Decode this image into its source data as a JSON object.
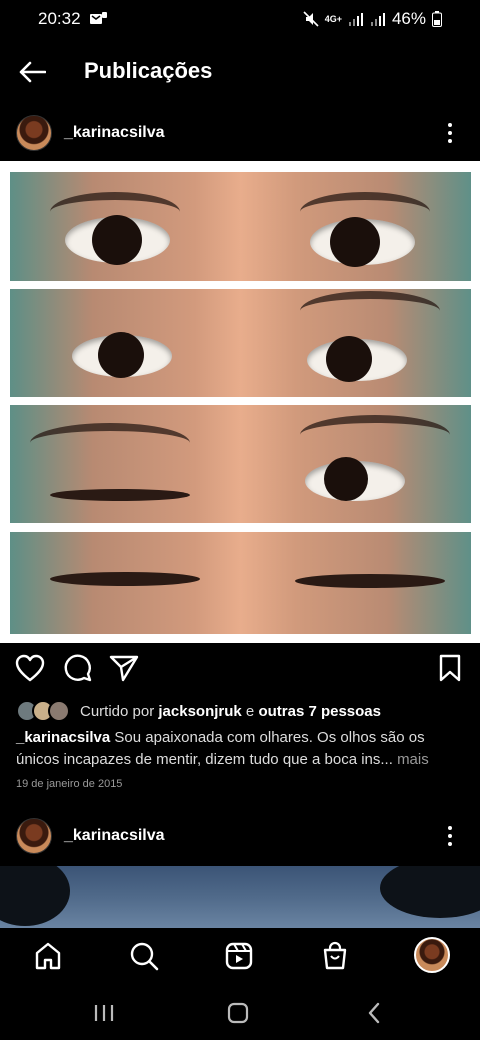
{
  "status_bar": {
    "time": "20:32",
    "battery": "46%",
    "network": "4G+"
  },
  "header": {
    "title": "Publicações",
    "back_icon": "arrow-left-icon"
  },
  "post": {
    "username": "_karinacsilva",
    "liked_by_prefix": "Curtido por",
    "liked_by_user": "jacksonjruk",
    "liked_by_and": "e",
    "liked_by_others": "outras 7 pessoas",
    "caption_user": "_karinacsilva",
    "caption_text": "Sou apaixonada com olhares. Os olhos são os únicos incapazes de mentir, dizem tudo que a boca ins...",
    "caption_more": "mais",
    "date": "19 de janeiro de 2015"
  },
  "post2": {
    "username": "_karinacsilva"
  },
  "colors": {
    "background": "#000000",
    "text": "#ffffff",
    "secondary_text": "#999999"
  },
  "icons": {
    "like": "heart-icon",
    "comment": "comment-icon",
    "share": "send-icon",
    "save": "bookmark-icon",
    "home": "home-icon",
    "search": "search-icon",
    "reels": "reels-icon",
    "shop": "shop-icon"
  }
}
